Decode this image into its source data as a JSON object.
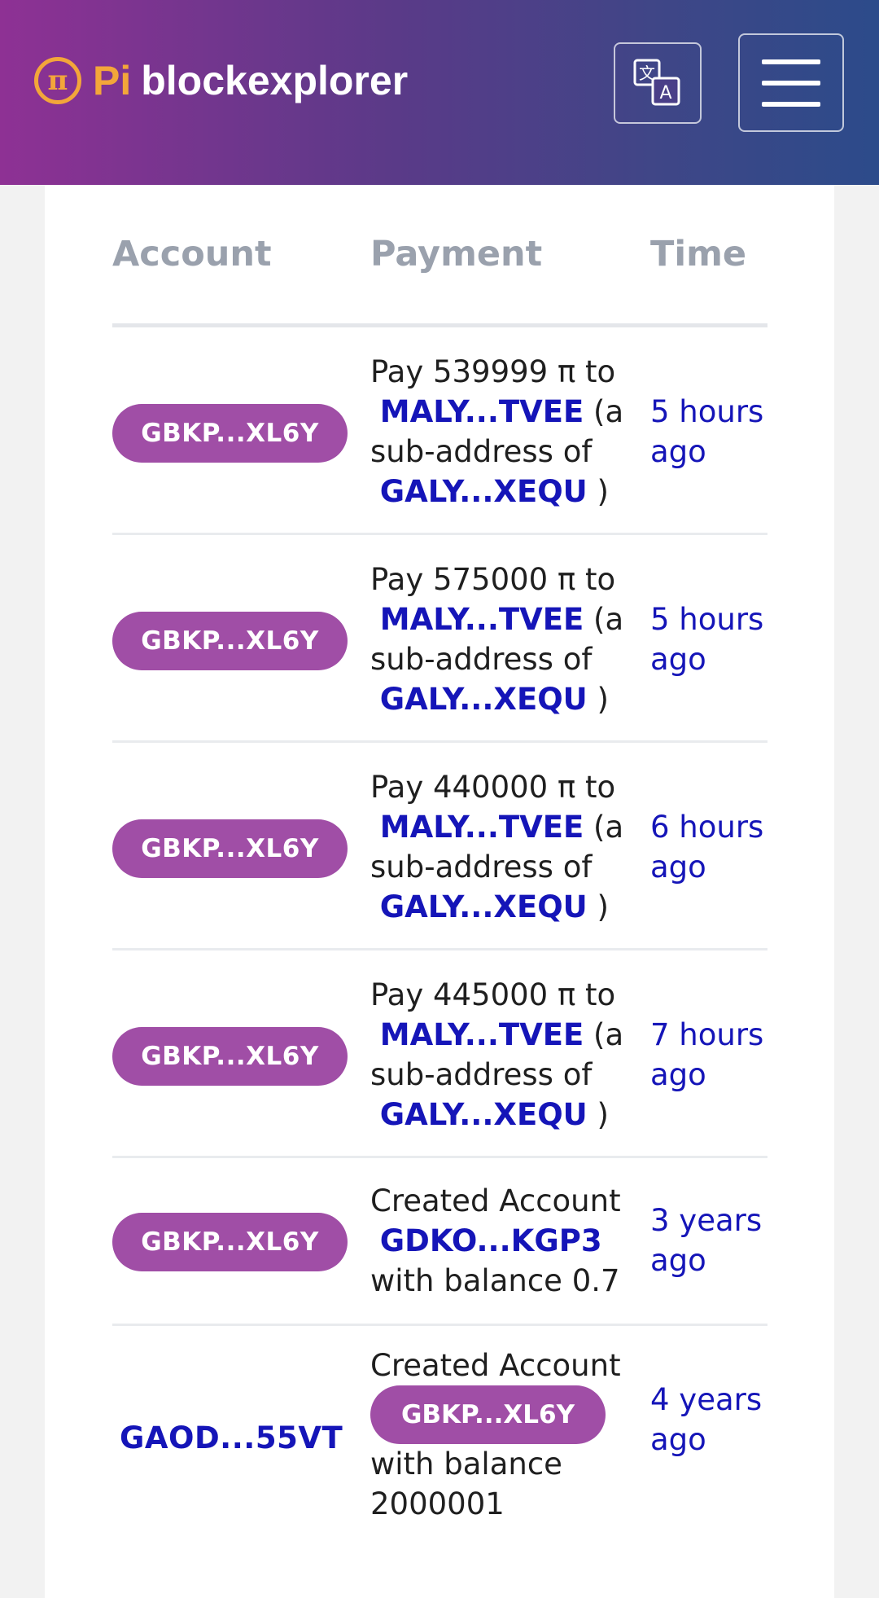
{
  "header": {
    "logo_pi": "Pi",
    "logo_rest": "blockexplorer",
    "logo_icon_glyph": "π",
    "translate_icon": "translate-icon",
    "menu_icon": "hamburger-menu-icon",
    "gradient_start": "#8e3194",
    "gradient_end": "#2c4b8a",
    "accent": "#f3a63a"
  },
  "table": {
    "columns": [
      "Account",
      "Payment",
      "Time"
    ],
    "rows": [
      {
        "account": "GBKP...XL6Y",
        "line1": "Pay 539999 π to",
        "link1": "MALY...TVEE",
        "after1": " (a",
        "line3": "sub-address of",
        "link2": "GALY...XEQU",
        "after2": " )",
        "time1": "5 hours",
        "time2": "ago"
      },
      {
        "account": "GBKP...XL6Y",
        "line1": "Pay 575000 π to",
        "link1": "MALY...TVEE",
        "after1": " (a",
        "line3": "sub-address of",
        "link2": "GALY...XEQU",
        "after2": " )",
        "time1": "5 hours",
        "time2": "ago"
      },
      {
        "account": "GBKP...XL6Y",
        "line1": "Pay 440000 π to",
        "link1": "MALY...TVEE",
        "after1": " (a",
        "line3": "sub-address of",
        "link2": "GALY...XEQU",
        "after2": " )",
        "time1": "6 hours",
        "time2": "ago"
      },
      {
        "account": "GBKP...XL6Y",
        "line1": "Pay 445000 π to",
        "link1": "MALY...TVEE",
        "after1": " (a",
        "line3": "sub-address of",
        "link2": "GALY...XEQU",
        "after2": " )",
        "time1": "7 hours",
        "time2": "ago"
      },
      {
        "account": "GBKP...XL6Y",
        "line1": "Created Account",
        "link1": "GDKO...KGP3",
        "line3": "with balance 0.7",
        "time1": "3 years",
        "time2": "ago"
      },
      {
        "account": "GAOD...55VT",
        "line1": "Created Account",
        "pill": "GBKP...XL6Y",
        "line3": "with balance",
        "line4": "2000001",
        "time1": "4 years",
        "time2": "ago"
      }
    ]
  },
  "colors": {
    "pill": "#a04ea6",
    "link": "#1515b8",
    "header_text": "#9aa1ad"
  }
}
